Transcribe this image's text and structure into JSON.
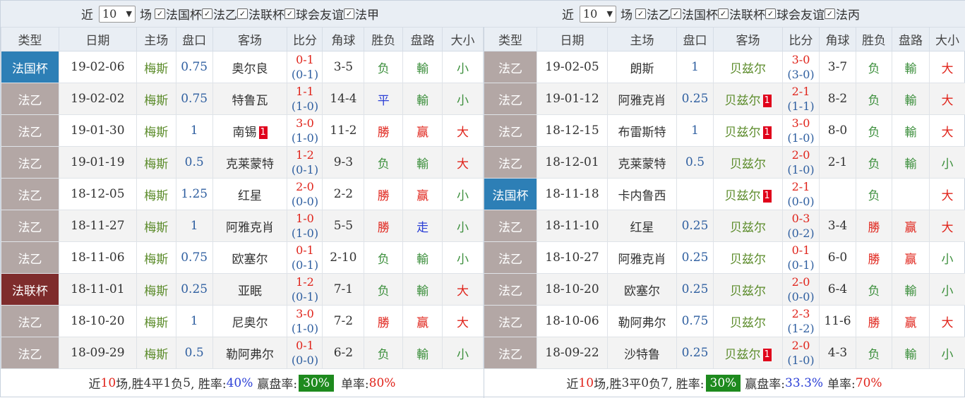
{
  "colors": {
    "cup": "#2d7fb6",
    "league": "#b3a7a5",
    "league_cup": "#7e2c2c",
    "home_highlight": "#5b8b2a",
    "win_rate_box": "#1e8a1e",
    "red": "#e0241b",
    "blue": "#2b3fd6",
    "green": "#3c8f3c"
  },
  "icons": [
    "dropdown-arrow-icon",
    "checkbox-checked-icon",
    "red-card-icon"
  ],
  "left": {
    "filter": {
      "near_label": "近",
      "count": "10",
      "count_arrow": "▼",
      "suffix": "场",
      "checks": [
        "法国杯",
        "法乙",
        "法联杯",
        "球会友谊",
        "法甲"
      ]
    },
    "headers": [
      "类型",
      "日期",
      "主场",
      "盘口",
      "客场",
      "比分",
      "角球",
      "胜负",
      "盘路",
      "大小"
    ],
    "rows": [
      {
        "type": "法国杯",
        "type_kind": "cup",
        "date": "19-02-06",
        "home": "梅斯",
        "home_hl": true,
        "handicap": "0.75",
        "away": "奥尔良",
        "away_hl": false,
        "away_red": "",
        "score": "0-1",
        "ht": "(0-1)",
        "corners": "3-5",
        "result": "负",
        "result_c": "green",
        "pan": "輸",
        "pan_c": "green",
        "ou": "小",
        "ou_c": "green"
      },
      {
        "type": "法乙",
        "type_kind": "league",
        "date": "19-02-02",
        "home": "梅斯",
        "home_hl": true,
        "handicap": "0.75",
        "away": "特鲁瓦",
        "away_hl": false,
        "away_red": "",
        "score": "1-1",
        "ht": "(1-0)",
        "corners": "14-4",
        "result": "平",
        "result_c": "blue",
        "pan": "輸",
        "pan_c": "green",
        "ou": "小",
        "ou_c": "green"
      },
      {
        "type": "法乙",
        "type_kind": "league",
        "date": "19-01-30",
        "home": "梅斯",
        "home_hl": true,
        "handicap": "1",
        "away": "南锡",
        "away_hl": false,
        "away_red": "1",
        "score": "3-0",
        "ht": "(1-0)",
        "corners": "11-2",
        "result": "勝",
        "result_c": "red",
        "pan": "赢",
        "pan_c": "red",
        "ou": "大",
        "ou_c": "red"
      },
      {
        "type": "法乙",
        "type_kind": "league",
        "date": "19-01-19",
        "home": "梅斯",
        "home_hl": true,
        "handicap": "0.5",
        "away": "克莱蒙特",
        "away_hl": false,
        "away_red": "",
        "score": "1-2",
        "ht": "(0-1)",
        "corners": "9-3",
        "result": "负",
        "result_c": "green",
        "pan": "輸",
        "pan_c": "green",
        "ou": "大",
        "ou_c": "red"
      },
      {
        "type": "法乙",
        "type_kind": "league",
        "date": "18-12-05",
        "home": "梅斯",
        "home_hl": true,
        "handicap": "1.25",
        "away": "红星",
        "away_hl": false,
        "away_red": "",
        "score": "2-0",
        "ht": "(0-0)",
        "corners": "2-2",
        "result": "勝",
        "result_c": "red",
        "pan": "赢",
        "pan_c": "red",
        "ou": "小",
        "ou_c": "green"
      },
      {
        "type": "法乙",
        "type_kind": "league",
        "date": "18-11-27",
        "home": "梅斯",
        "home_hl": true,
        "handicap": "1",
        "away": "阿雅克肖",
        "away_hl": false,
        "away_red": "",
        "score": "1-0",
        "ht": "(1-0)",
        "corners": "5-5",
        "result": "勝",
        "result_c": "red",
        "pan": "走",
        "pan_c": "blue",
        "ou": "小",
        "ou_c": "green"
      },
      {
        "type": "法乙",
        "type_kind": "league",
        "date": "18-11-06",
        "home": "梅斯",
        "home_hl": true,
        "handicap": "0.75",
        "away": "欧塞尔",
        "away_hl": false,
        "away_red": "",
        "score": "0-1",
        "ht": "(0-1)",
        "corners": "2-10",
        "result": "负",
        "result_c": "green",
        "pan": "輸",
        "pan_c": "green",
        "ou": "小",
        "ou_c": "green"
      },
      {
        "type": "法联杯",
        "type_kind": "league_cup",
        "date": "18-11-01",
        "home": "梅斯",
        "home_hl": true,
        "handicap": "0.25",
        "away": "亚眠",
        "away_hl": false,
        "away_red": "",
        "score": "1-2",
        "ht": "(0-1)",
        "corners": "7-1",
        "result": "负",
        "result_c": "green",
        "pan": "輸",
        "pan_c": "green",
        "ou": "大",
        "ou_c": "red"
      },
      {
        "type": "法乙",
        "type_kind": "league",
        "date": "18-10-20",
        "home": "梅斯",
        "home_hl": true,
        "handicap": "1",
        "away": "尼奥尔",
        "away_hl": false,
        "away_red": "",
        "score": "3-0",
        "ht": "(1-0)",
        "corners": "7-2",
        "result": "勝",
        "result_c": "red",
        "pan": "赢",
        "pan_c": "red",
        "ou": "大",
        "ou_c": "red"
      },
      {
        "type": "法乙",
        "type_kind": "league",
        "date": "18-09-29",
        "home": "梅斯",
        "home_hl": true,
        "handicap": "0.5",
        "away": "勒阿弗尔",
        "away_hl": false,
        "away_red": "",
        "score": "0-1",
        "ht": "(0-0)",
        "corners": "6-2",
        "result": "负",
        "result_c": "green",
        "pan": "輸",
        "pan_c": "green",
        "ou": "小",
        "ou_c": "green"
      }
    ],
    "summary": {
      "p1": "近",
      "n": "10",
      "p2": "场,胜",
      "w": "4",
      "p3": "平",
      "d": "1",
      "p4": "负",
      "l": "5",
      "p5": ", 胜率:",
      "win_rate": "40%",
      "p6": "赢盘率:",
      "pan_rate": "30%",
      "p7": "单率:",
      "odd_rate": "80%"
    }
  },
  "right": {
    "filter": {
      "near_label": "近",
      "count": "10",
      "count_arrow": "▼",
      "suffix": "场",
      "checks": [
        "法乙",
        "法国杯",
        "法联杯",
        "球会友谊",
        "法丙"
      ]
    },
    "headers": [
      "类型",
      "日期",
      "主场",
      "盘口",
      "客场",
      "比分",
      "角球",
      "胜负",
      "盘路",
      "大小"
    ],
    "rows": [
      {
        "type": "法乙",
        "type_kind": "league",
        "date": "19-02-05",
        "home": "朗斯",
        "home_hl": false,
        "handicap": "1",
        "away": "贝兹尔",
        "away_hl": true,
        "away_red": "",
        "score": "3-0",
        "ht": "(3-0)",
        "corners": "3-7",
        "result": "负",
        "result_c": "green",
        "pan": "輸",
        "pan_c": "green",
        "ou": "大",
        "ou_c": "red"
      },
      {
        "type": "法乙",
        "type_kind": "league",
        "date": "19-01-12",
        "home": "阿雅克肖",
        "home_hl": false,
        "handicap": "0.25",
        "away": "贝兹尔",
        "away_hl": true,
        "away_red": "1",
        "score": "2-1",
        "ht": "(1-1)",
        "corners": "8-2",
        "result": "负",
        "result_c": "green",
        "pan": "輸",
        "pan_c": "green",
        "ou": "大",
        "ou_c": "red"
      },
      {
        "type": "法乙",
        "type_kind": "league",
        "date": "18-12-15",
        "home": "布雷斯特",
        "home_hl": false,
        "handicap": "1",
        "away": "贝兹尔",
        "away_hl": true,
        "away_red": "1",
        "score": "3-0",
        "ht": "(1-0)",
        "corners": "8-0",
        "result": "负",
        "result_c": "green",
        "pan": "輸",
        "pan_c": "green",
        "ou": "大",
        "ou_c": "red"
      },
      {
        "type": "法乙",
        "type_kind": "league",
        "date": "18-12-01",
        "home": "克莱蒙特",
        "home_hl": false,
        "handicap": "0.5",
        "away": "贝兹尔",
        "away_hl": true,
        "away_red": "",
        "score": "2-0",
        "ht": "(1-0)",
        "corners": "2-1",
        "result": "负",
        "result_c": "green",
        "pan": "輸",
        "pan_c": "green",
        "ou": "小",
        "ou_c": "green"
      },
      {
        "type": "法国杯",
        "type_kind": "cup",
        "date": "18-11-18",
        "home": "卡内鲁西",
        "home_hl": false,
        "handicap": "",
        "away": "贝兹尔",
        "away_hl": true,
        "away_red": "1",
        "score": "2-1",
        "ht": "(0-0)",
        "corners": "",
        "result": "负",
        "result_c": "green",
        "pan": "",
        "pan_c": "green",
        "ou": "大",
        "ou_c": "red"
      },
      {
        "type": "法乙",
        "type_kind": "league",
        "date": "18-11-10",
        "home": "红星",
        "home_hl": false,
        "handicap": "0.25",
        "away": "贝兹尔",
        "away_hl": true,
        "away_red": "",
        "score": "0-3",
        "ht": "(0-2)",
        "corners": "3-4",
        "result": "勝",
        "result_c": "red",
        "pan": "赢",
        "pan_c": "red",
        "ou": "大",
        "ou_c": "red"
      },
      {
        "type": "法乙",
        "type_kind": "league",
        "date": "18-10-27",
        "home": "阿雅克肖",
        "home_hl": false,
        "handicap": "0.25",
        "away": "贝兹尔",
        "away_hl": true,
        "away_red": "",
        "score": "0-1",
        "ht": "(0-1)",
        "corners": "6-0",
        "result": "勝",
        "result_c": "red",
        "pan": "赢",
        "pan_c": "red",
        "ou": "小",
        "ou_c": "green"
      },
      {
        "type": "法乙",
        "type_kind": "league",
        "date": "18-10-20",
        "home": "欧塞尔",
        "home_hl": false,
        "handicap": "0.25",
        "away": "贝兹尔",
        "away_hl": true,
        "away_red": "",
        "score": "2-0",
        "ht": "(0-0)",
        "corners": "6-4",
        "result": "负",
        "result_c": "green",
        "pan": "輸",
        "pan_c": "green",
        "ou": "小",
        "ou_c": "green"
      },
      {
        "type": "法乙",
        "type_kind": "league",
        "date": "18-10-06",
        "home": "勒阿弗尔",
        "home_hl": false,
        "handicap": "0.75",
        "away": "贝兹尔",
        "away_hl": true,
        "away_red": "",
        "score": "2-3",
        "ht": "(1-2)",
        "corners": "11-6",
        "result": "勝",
        "result_c": "red",
        "pan": "赢",
        "pan_c": "red",
        "ou": "大",
        "ou_c": "red"
      },
      {
        "type": "法乙",
        "type_kind": "league",
        "date": "18-09-22",
        "home": "沙特鲁",
        "home_hl": false,
        "handicap": "0.25",
        "away": "贝兹尔",
        "away_hl": true,
        "away_red": "1",
        "score": "2-0",
        "ht": "(1-0)",
        "corners": "4-3",
        "result": "负",
        "result_c": "green",
        "pan": "輸",
        "pan_c": "green",
        "ou": "小",
        "ou_c": "green"
      }
    ],
    "summary": {
      "p1": "近",
      "n": "10",
      "p2": "场,胜",
      "w": "3",
      "p3": "平",
      "d": "0",
      "p4": "负",
      "l": "7",
      "p5": ", 胜率:",
      "win_rate": "30%",
      "p6": "赢盘率:",
      "pan_rate": "33.3%",
      "p7": "单率:",
      "odd_rate": "70%"
    }
  }
}
